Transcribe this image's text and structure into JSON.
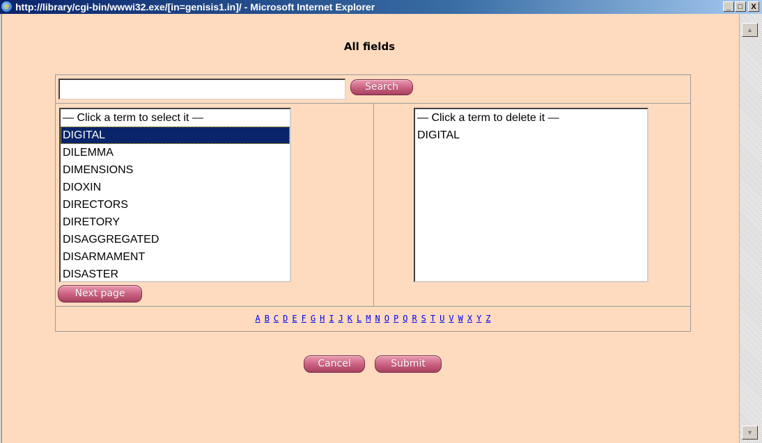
{
  "window": {
    "title": "http://library/cgi-bin/wwwi32.exe/[in=genisis1.in]/ - Microsoft Internet Explorer",
    "minimize_glyph": "_",
    "maximize_glyph": "□",
    "close_glyph": "X",
    "icon": "ie-icon"
  },
  "page": {
    "heading": "All fields"
  },
  "search": {
    "value": "",
    "button_label": "Search"
  },
  "select_list": {
    "header": "— Click a term to select it —",
    "items": [
      "DIGITAL",
      "DILEMMA",
      "DIMENSIONS",
      "DIOXIN",
      "DIRECTORS",
      "DIRETORY",
      "DISAGGREGATED",
      "DISARMAMENT",
      "DISASTER"
    ],
    "selected": "DIGITAL"
  },
  "next_page_label": "Next page",
  "delete_list": {
    "header": "— Click a term to delete it —",
    "items": [
      "DIGITAL"
    ]
  },
  "alphabet": [
    "A",
    "B",
    "C",
    "D",
    "E",
    "F",
    "G",
    "H",
    "I",
    "J",
    "K",
    "L",
    "M",
    "N",
    "O",
    "P",
    "Q",
    "R",
    "S",
    "T",
    "U",
    "V",
    "W",
    "X",
    "Y",
    "Z"
  ],
  "actions": {
    "cancel_label": "Cancel",
    "submit_label": "Submit"
  },
  "colors": {
    "page_background": "#fedbbf",
    "button_pink": "#c95f7f",
    "selection": "#0a246a",
    "link": "#0000ee"
  }
}
